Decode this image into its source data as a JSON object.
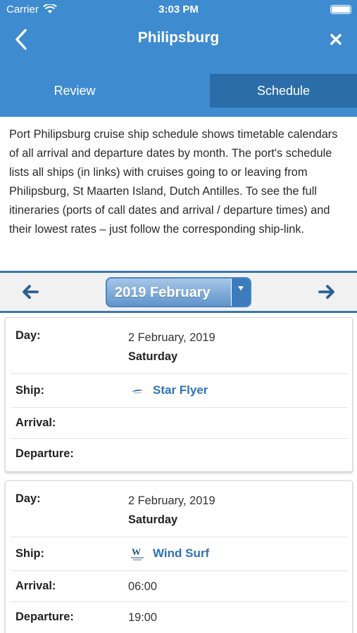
{
  "status": {
    "carrier": "Carrier",
    "time": "3:03 PM"
  },
  "nav": {
    "title": "Philipsburg",
    "back_icon": "chevron-left-icon",
    "close_icon": "close-icon"
  },
  "tabs": [
    {
      "label": "Review",
      "active": false
    },
    {
      "label": "Schedule",
      "active": true
    }
  ],
  "intro": "Port Philipsburg cruise ship schedule shows timetable calendars of all arrival and departure dates by month. The port's schedule lists all ships (in links) with cruises going to or leaving from Philipsburg, St Maarten Island, Dutch Antilles. To see the full itineraries (ports of call dates and arrival / departure times) and their lowest rates – just follow the corresponding ship-link.",
  "month_selector": {
    "selected": "2019 February",
    "prev_icon": "arrow-left-icon",
    "next_icon": "arrow-right-icon"
  },
  "labels": {
    "day": "Day:",
    "ship": "Ship:",
    "arrival": "Arrival:",
    "departure": "Departure:"
  },
  "entries": [
    {
      "date": "2 February, 2019",
      "weekday": "Saturday",
      "ship": "Star Flyer",
      "ship_logo": "star-clippers-logo-icon",
      "arrival": "",
      "departure": ""
    },
    {
      "date": "2 February, 2019",
      "weekday": "Saturday",
      "ship": "Wind Surf",
      "ship_logo": "windstar-logo-icon",
      "arrival": "06:00",
      "departure": "19:00"
    }
  ],
  "colors": {
    "header": "#3f8bd0",
    "tab_active": "#2b6da8",
    "link": "#2f72b4",
    "accent": "#3a76b0"
  }
}
